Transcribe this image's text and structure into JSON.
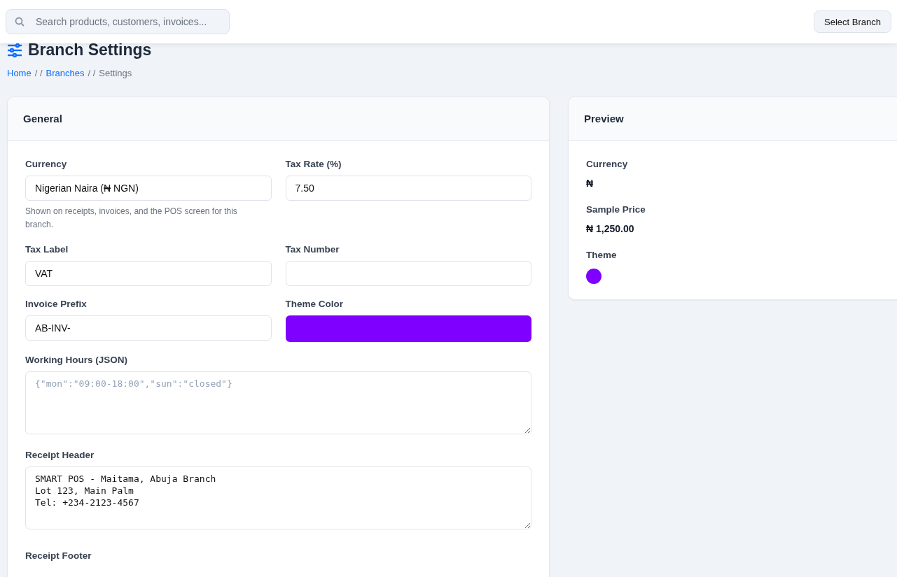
{
  "topbar": {
    "search": {
      "placeholder": "Search products, customers, invoices..."
    },
    "branch_button": "Select Branch"
  },
  "page": {
    "title": "Branch Settings",
    "breadcrumb": [
      {
        "label": "Home",
        "link": true
      },
      {
        "label": "Branches",
        "link": true
      },
      {
        "label": "Settings",
        "link": false
      }
    ],
    "separator": "/ /"
  },
  "general": {
    "title": "General",
    "fields": [
      {
        "kind": "input",
        "label": "Currency",
        "value": "Nigerian Naira (₦ NGN)",
        "help": "Shown on receipts, invoices, and the POS screen for this branch."
      },
      {
        "kind": "input",
        "label": "Tax Rate (%)",
        "value": "7.50"
      },
      {
        "kind": "input",
        "label": "Tax Label",
        "value": "VAT"
      },
      {
        "kind": "input",
        "label": "Tax Number"
      },
      {
        "kind": "input",
        "label": "Invoice Prefix",
        "value": "AB-INV-"
      },
      {
        "kind": "color",
        "label": "Theme Color",
        "color": "#7f00ff"
      },
      {
        "kind": "textarea",
        "label": "Working Hours (JSON)",
        "placeholder": "{\"mon\":\"09:00-18:00\",\"sun\":\"closed\"}"
      },
      {
        "kind": "textarea",
        "label": "Receipt Header",
        "value": "SMART POS - Maitama, Abuja Branch\nLot 123, Main Palm\nTel: +234-2123-4567"
      },
      {
        "kind": "cut",
        "label": "Receipt Footer"
      }
    ]
  },
  "preview": {
    "title": "Preview",
    "items": [
      {
        "kind": "text",
        "label": "Currency",
        "value": "₦"
      },
      {
        "kind": "text",
        "label": "Sample Price",
        "value": "₦ 1,250.00"
      },
      {
        "kind": "swatch",
        "label": "Theme",
        "color": "#7f00ff"
      }
    ]
  }
}
